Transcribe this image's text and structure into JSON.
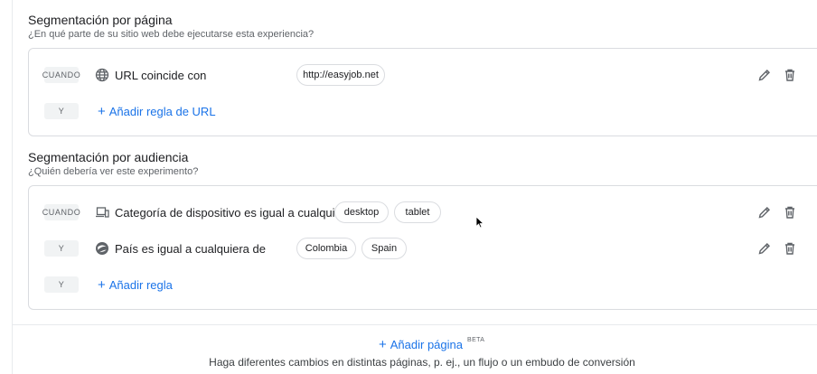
{
  "page_section": {
    "title": "Segmentación por página",
    "subtitle": "¿En qué parte de su sitio web debe ejecutarse esta experiencia?",
    "rules": [
      {
        "condition": "CUANDO",
        "icon": "globe-icon",
        "text": "URL coincide con",
        "values": [
          "http://easyjob.net"
        ]
      }
    ],
    "add_row_condition": "Y",
    "add_label": "Añadir regla de URL"
  },
  "audience_section": {
    "title": "Segmentación por audiencia",
    "subtitle": "¿Quién debería ver este experimento?",
    "rules": [
      {
        "condition": "CUANDO",
        "icon": "devices-icon",
        "text": "Categoría de dispositivo es igual a cualquiera de",
        "values": [
          "desktop",
          "tablet"
        ]
      },
      {
        "condition": "Y",
        "icon": "explore-icon",
        "text": "País es igual a cualquiera de",
        "values": [
          "Colombia",
          "Spain"
        ]
      }
    ],
    "add_row_condition": "Y",
    "add_label": "Añadir regla"
  },
  "footer": {
    "add_page_label": "Añadir página",
    "beta_badge": "BETA",
    "description": "Haga diferentes cambios en distintas páginas, p. ej., un flujo o un embudo de conversión"
  },
  "colors": {
    "accent": "#1a73e8",
    "border": "#dadce0",
    "muted_text": "#5f6368"
  }
}
